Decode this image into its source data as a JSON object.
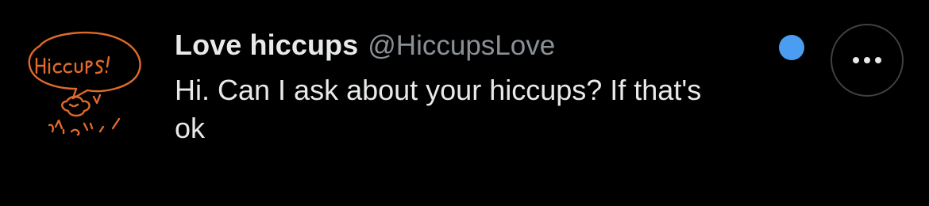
{
  "post": {
    "author": {
      "display_name": "Love hiccups",
      "handle": "@HiccupsLove",
      "avatar_text": "Hiccups!"
    },
    "text": "Hi. Can I ask about your hiccups? If that's ok",
    "unread_indicator_color": "#4a9df0",
    "more_icon": "ellipsis-icon"
  },
  "colors": {
    "background": "#000000",
    "primary_text": "#e7e9ea",
    "secondary_text": "#8b9096",
    "avatar_ink": "#e06a2a"
  }
}
